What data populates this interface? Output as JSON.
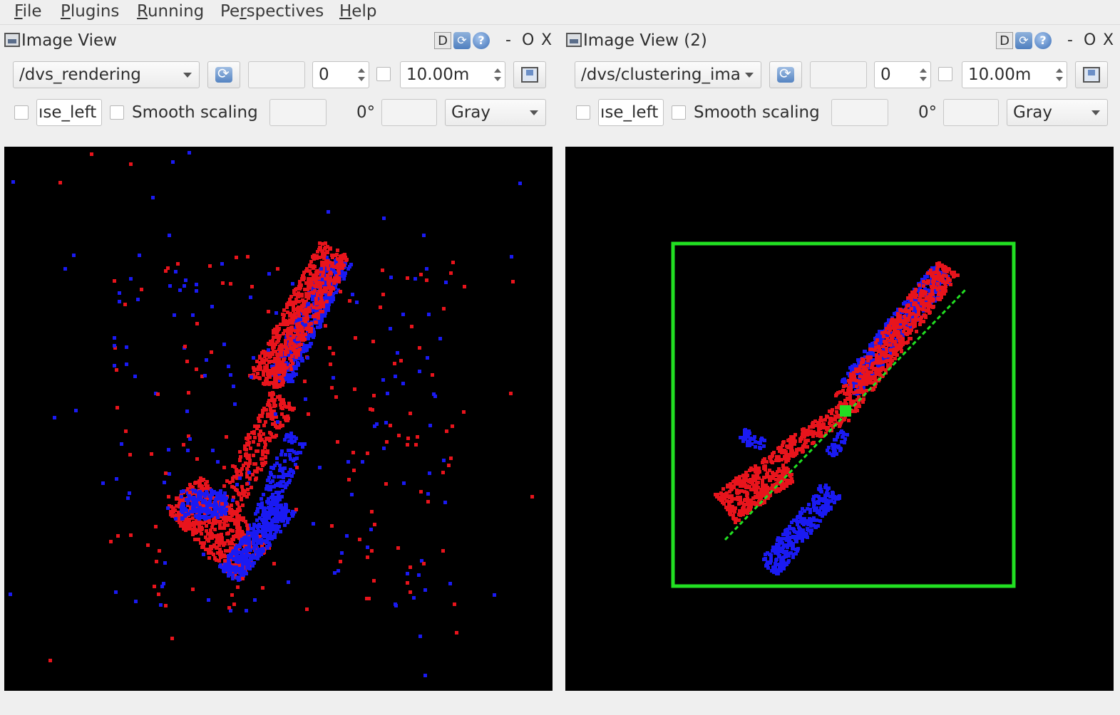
{
  "menu": [
    {
      "acc": "F",
      "rest": "ile"
    },
    {
      "acc": "P",
      "rest": "lugins"
    },
    {
      "acc": "R",
      "rest": "unning"
    },
    {
      "pre": "Pe",
      "acc": "r",
      "rest": "spectives"
    },
    {
      "acc": "H",
      "rest": "elp"
    }
  ],
  "panels": [
    {
      "title": "Image View",
      "topic": "/dvs_rendering",
      "frame": "0",
      "max_range": "10.00m",
      "mouse_label": "ıse_left",
      "smooth_label": "Smooth scaling",
      "rotation": "0°",
      "colormap": "Gray",
      "title_buttons": {
        "d": "D",
        "min": "-",
        "float": "O",
        "close": "X"
      }
    },
    {
      "title": "Image View (2)",
      "topic": "/dvs/clustering_ima",
      "frame": "0",
      "max_range": "10.00m",
      "mouse_label": "ıse_left",
      "smooth_label": "Smooth scaling",
      "rotation": "0°",
      "colormap": "Gray",
      "title_buttons": {
        "d": "D",
        "min": "-",
        "float": "O",
        "close": "X"
      }
    }
  ],
  "colors": {
    "event_positive": "#e8141c",
    "event_negative": "#1a1af2",
    "cluster_box": "#22e022",
    "background": "#000000"
  }
}
